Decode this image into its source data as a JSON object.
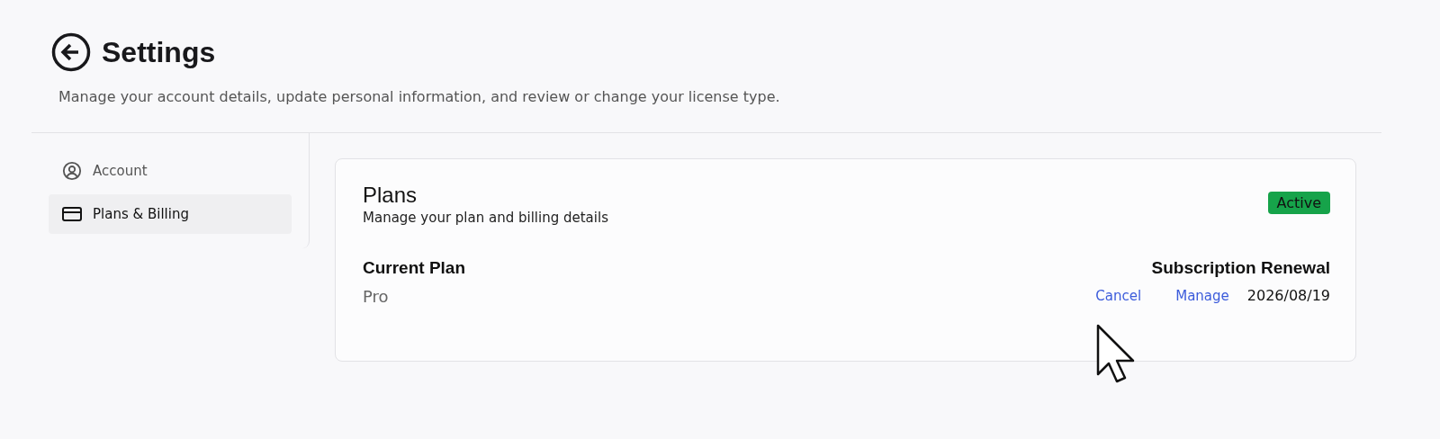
{
  "header": {
    "title": "Settings",
    "description": "Manage your account details, update personal information, and review or change your license type."
  },
  "sidebar": {
    "items": [
      {
        "label": "Account",
        "selected": false
      },
      {
        "label": "Plans & Billing",
        "selected": true
      }
    ]
  },
  "plan_card": {
    "title": "Plans",
    "subtitle": "Manage your plan and billing details",
    "status": "Active",
    "current_plan": {
      "label": "Current Plan",
      "value": "Pro"
    },
    "renewal": {
      "label": "Subscription Renewal",
      "links": [
        "Cancel",
        "Manage"
      ],
      "date": "2026/08/19"
    }
  }
}
